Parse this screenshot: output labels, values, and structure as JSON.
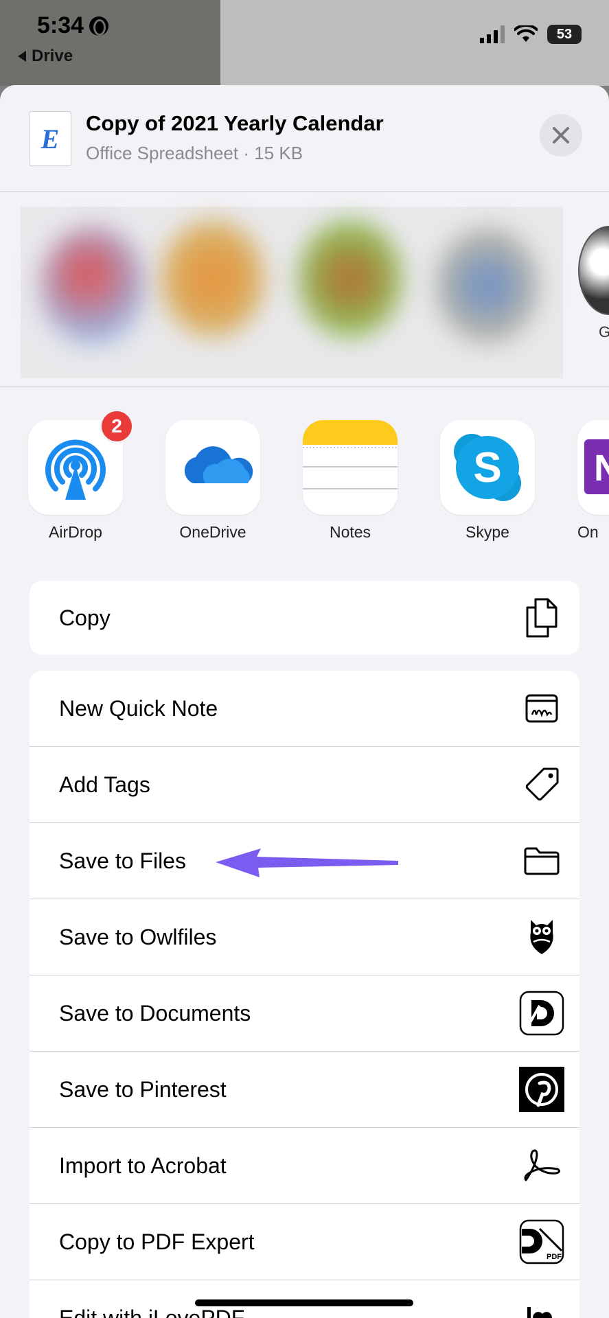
{
  "status_bar": {
    "time": "5:34",
    "back_label": "Drive",
    "battery": "53"
  },
  "header": {
    "file_icon_letter": "E",
    "title": "Copy of 2021 Yearly Calendar",
    "subtitle": "Office Spreadsheet · 15 KB",
    "close_icon": "xmark-icon"
  },
  "people": {
    "edge_label": "G"
  },
  "apps": [
    {
      "label": "AirDrop",
      "icon": "airdrop-icon",
      "badge": "2"
    },
    {
      "label": "OneDrive",
      "icon": "onedrive-icon"
    },
    {
      "label": "Notes",
      "icon": "notes-icon"
    },
    {
      "label": "Skype",
      "icon": "skype-icon"
    },
    {
      "label": "On",
      "icon": "onenote-icon"
    }
  ],
  "actions_primary": [
    {
      "label": "Copy",
      "icon": "copy-icon"
    }
  ],
  "actions": [
    {
      "label": "New Quick Note",
      "icon": "quick-note-icon"
    },
    {
      "label": "Add Tags",
      "icon": "tag-icon"
    },
    {
      "label": "Save to Files",
      "icon": "folder-icon"
    },
    {
      "label": "Save to Owlfiles",
      "icon": "owl-icon"
    },
    {
      "label": "Save to Documents",
      "icon": "documents-icon"
    },
    {
      "label": "Save to Pinterest",
      "icon": "pinterest-icon"
    },
    {
      "label": "Import to Acrobat",
      "icon": "acrobat-icon"
    },
    {
      "label": "Copy to PDF Expert",
      "icon": "pdf-expert-icon"
    },
    {
      "label": "Edit with iLovePDF",
      "icon": "ilovepdf-icon"
    }
  ],
  "annotation": {
    "arrow_color": "#7a5cf0"
  }
}
